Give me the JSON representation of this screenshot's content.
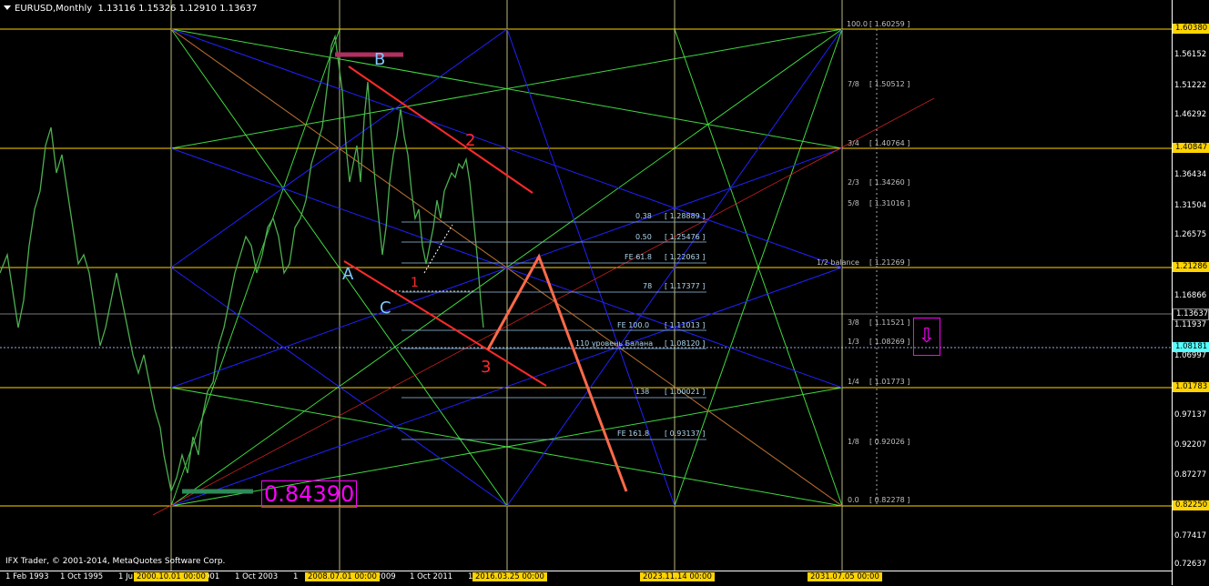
{
  "chart_header": {
    "symbol_period": "EURUSD,Monthly",
    "ohlc": "1.13116 1.15326 1.12910 1.13637"
  },
  "copyright": "IFX Trader, © 2001-2014, MetaQuotes Software Corp.",
  "price_axis": {
    "ticks": [
      "1.56152",
      "1.51222",
      "1.46292",
      "1.36434",
      "1.31504",
      "1.26575",
      "1.16866",
      "1.11937",
      "1.06997",
      "0.97137",
      "0.92207",
      "0.87277",
      "0.77417",
      "0.72637"
    ],
    "tags": {
      "top": "1.60380",
      "upper": "1.40847",
      "mid": "1.21286",
      "current": "1.13637",
      "bid": "1.08181",
      "lower": "1.01783",
      "bottom": "0.82250"
    }
  },
  "time_axis": {
    "ticks": [
      "1 Feb 1993",
      "1 Oct 1995",
      "1 Ju",
      "001",
      "1 Oct 2003",
      "1 ",
      "2009",
      "1 Oct 2011",
      "1 "
    ],
    "tags": [
      "2000.10.01 00:00",
      "2008.07.01 00:00",
      "2016.03.25 00:00",
      "2023.11.14 00:00",
      "2031.07.05 00:00"
    ]
  },
  "fib_levels": [
    {
      "name": "0.38",
      "value": "[ 1.28889 ]"
    },
    {
      "name": "0.50",
      "value": "[ 1.25476 ]"
    },
    {
      "name": "FE 61.8",
      "value": "[ 1.22063 ]"
    },
    {
      "name": "78",
      "value": "[ 1.17377 ]"
    },
    {
      "name": "FE 100.0",
      "value": "[ 1.11013 ]"
    },
    {
      "name": "110 уровень Балана",
      "value": "[ 1.08120 ]"
    },
    {
      "name": "138",
      "value": "[ 1.00021 ]"
    },
    {
      "name": "FE 161.8",
      "value": "[ 0.93137 ]"
    }
  ],
  "gann_levels": [
    {
      "name": "100.0",
      "value": "[ 1.60259 ]"
    },
    {
      "name": "7/8",
      "value": "[ 1.50512 ]"
    },
    {
      "name": "3/4",
      "value": "[ 1.40764 ]"
    },
    {
      "name": "2/3",
      "value": "[ 1.34260 ]"
    },
    {
      "name": "5/8",
      "value": "[ 1.31016 ]"
    },
    {
      "name": "1/2 balance",
      "value": "[ 1.21269 ]"
    },
    {
      "name": "3/8",
      "value": "[ 1.11521 ]"
    },
    {
      "name": "1/3",
      "value": "[ 1.08269 ]"
    },
    {
      "name": "1/4",
      "value": "[ 1.01773 ]"
    },
    {
      "name": "1/8",
      "value": "[ 0.92026 ]"
    },
    {
      "name": "0.0",
      "value": "[ 0.82278 ]"
    }
  ],
  "wave_marks": {
    "a": "A",
    "b": "B",
    "c": "C",
    "one": "1",
    "two": "2",
    "three": "3"
  },
  "low_label": "0.84390",
  "arrow_icon": "⇩",
  "colors": {
    "candles": "#4caf50",
    "fan_green": "#4cff4c",
    "fan_blue": "#2020ff",
    "trend_red": "#ff2a2a",
    "level_yellow": "#ffd400",
    "marker_magenta": "#ff00ff"
  }
}
